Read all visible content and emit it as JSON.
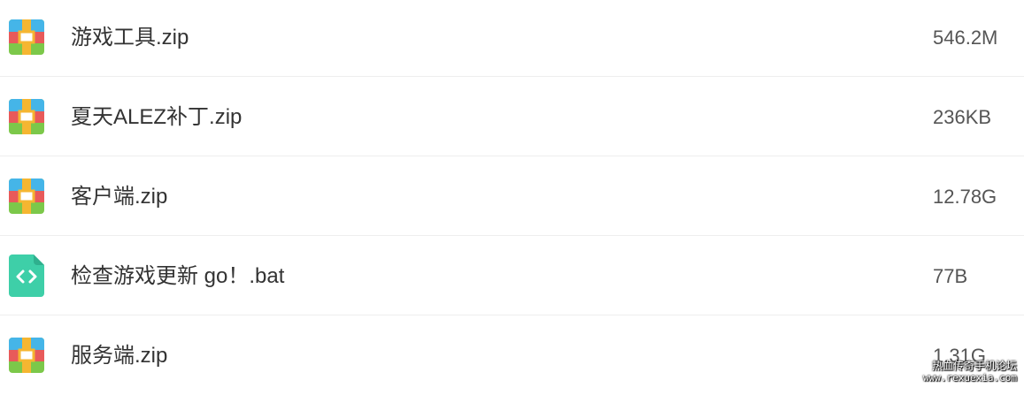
{
  "files": [
    {
      "name": "游戏工具.zip",
      "size": "546.2M",
      "icon": "zip-archive-icon"
    },
    {
      "name": "夏天ALEZ补丁.zip",
      "size": "236KB",
      "icon": "zip-archive-icon"
    },
    {
      "name": "客户端.zip",
      "size": "12.78G",
      "icon": "zip-archive-icon"
    },
    {
      "name": "检查游戏更新 go！.bat",
      "size": "77B",
      "icon": "code-file-icon"
    },
    {
      "name": "服务端.zip",
      "size": "1.31G",
      "icon": "zip-archive-icon"
    }
  ],
  "watermark": {
    "line1": "热血传奇手机论坛",
    "line2": "www.rexuexia.com"
  },
  "colors": {
    "zip_blue": "#45b5e8",
    "zip_red": "#e85a5a",
    "zip_green": "#7cc84a",
    "zip_band": "#f5b631",
    "code_file": "#3ecfa8",
    "divider": "#eeeeee"
  }
}
